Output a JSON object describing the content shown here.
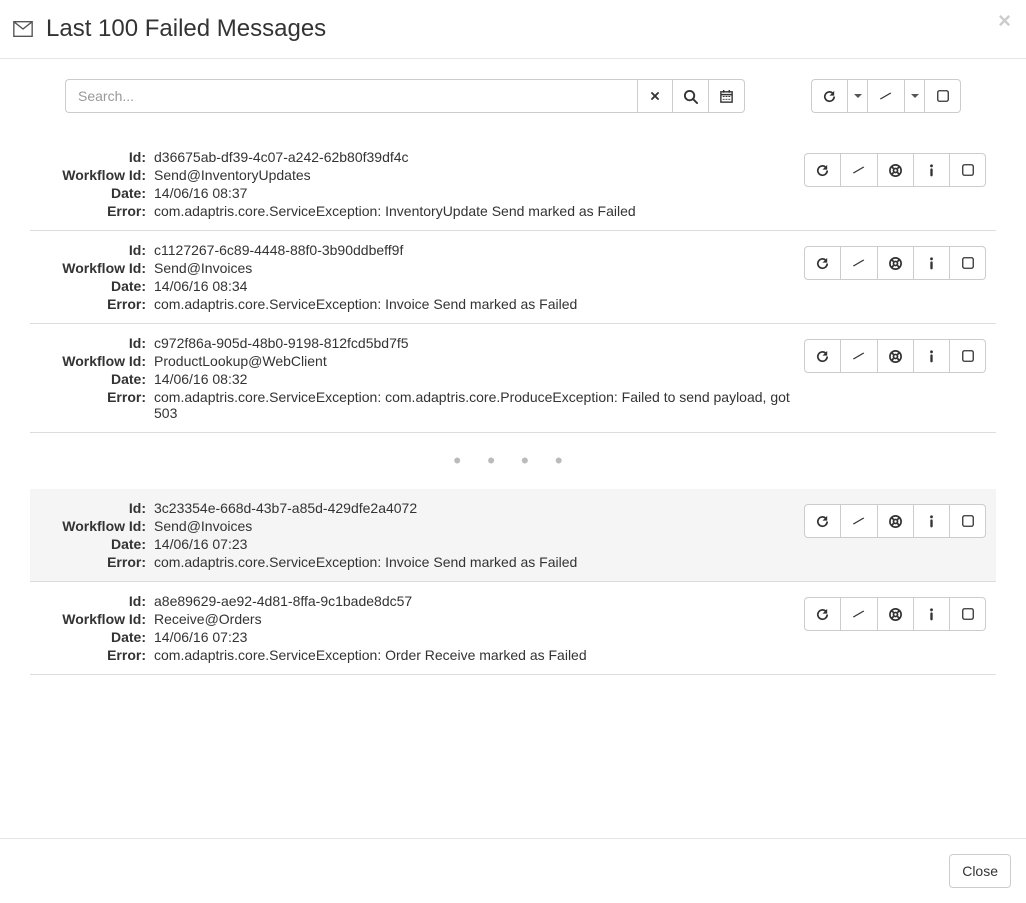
{
  "modal": {
    "title": "Last 100 Failed Messages",
    "close_label": "Close"
  },
  "toolbar": {
    "search_placeholder": "Search...",
    "icons": {
      "clear": "clear-icon",
      "search": "search-icon",
      "calendar": "calendar-icon",
      "refresh": "refresh-icon",
      "sweep": "sweep-icon",
      "checkbox": "checkbox-icon"
    }
  },
  "labels": {
    "id": "Id:",
    "workflow": "Workflow Id:",
    "date": "Date:",
    "error": "Error:"
  },
  "messages": [
    {
      "id": "d36675ab-df39-4c07-a242-62b80f39df4c",
      "workflow": "Send@InventoryUpdates",
      "date": "14/06/16 08:37",
      "error": "com.adaptris.core.ServiceException: InventoryUpdate Send marked as Failed",
      "highlight": false
    },
    {
      "id": "c1127267-6c89-4448-88f0-3b90ddbeff9f",
      "workflow": "Send@Invoices",
      "date": "14/06/16 08:34",
      "error": "com.adaptris.core.ServiceException: Invoice Send marked as Failed",
      "highlight": false
    },
    {
      "id": "c972f86a-905d-48b0-9198-812fcd5bd7f5",
      "workflow": "ProductLookup@WebClient",
      "date": "14/06/16 08:32",
      "error": "com.adaptris.core.ServiceException: com.adaptris.core.ProduceException: Failed to send payload, got 503",
      "highlight": false
    },
    {
      "id": "3c23354e-668d-43b7-a85d-429dfe2a4072",
      "workflow": "Send@Invoices",
      "date": "14/06/16 07:23",
      "error": "com.adaptris.core.ServiceException: Invoice Send marked as Failed",
      "highlight": true
    },
    {
      "id": "a8e89629-ae92-4d81-8ffa-9c1bade8dc57",
      "workflow": "Receive@Orders",
      "date": "14/06/16 07:23",
      "error": "com.adaptris.core.ServiceException: Order Receive marked as Failed",
      "highlight": false
    }
  ],
  "ellipsis": "• • • •"
}
